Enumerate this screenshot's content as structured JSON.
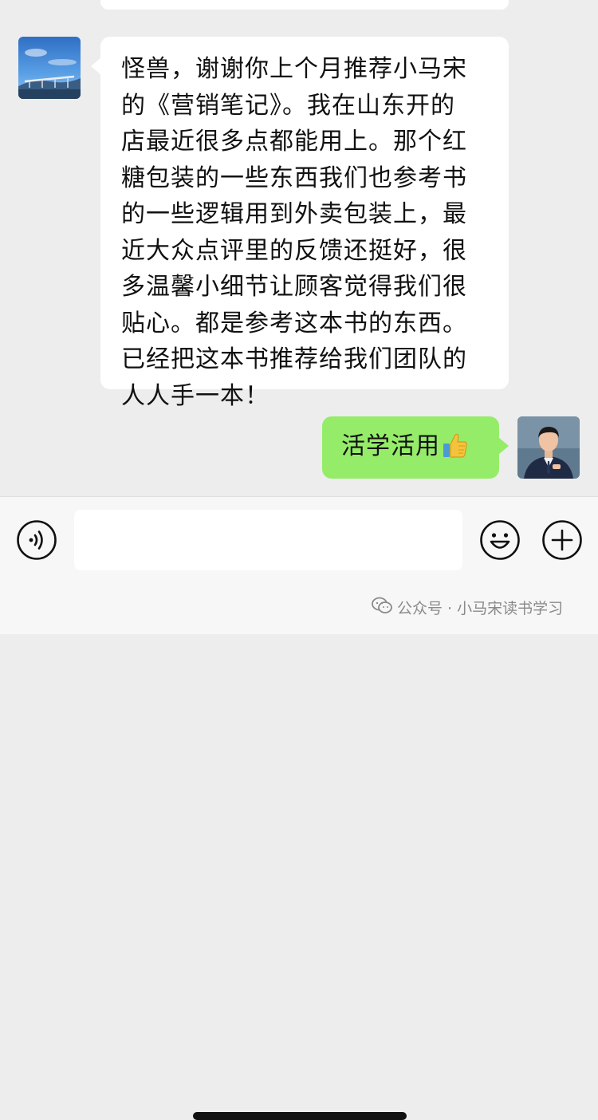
{
  "conversation": {
    "incoming": {
      "lines": [
        "怪兽，谢谢你上个月推荐小马宋",
        "的《营销笔记》。我在山东开的",
        "店最近很多点都能用上。那个红",
        "糖包装的一些东西我们也参考书",
        "的一些逻辑用到外卖包装上，最",
        "近大众点评里的反馈还挺好，很",
        "多温馨小细节让顾客觉得我们很",
        "贴心。都是参考这本书的东西。",
        "已经把这本书推荐给我们团队的",
        "人人手一本！"
      ]
    },
    "outgoing": {
      "text": "活学活用",
      "emoji_icon": "thumbs-up-icon"
    }
  },
  "input_bar": {
    "voice_icon": "voice-icon",
    "emoji_icon": "smiley-icon",
    "plus_icon": "plus-icon"
  },
  "watermark": {
    "text": "公众号 · 小马宋读书学习",
    "icon": "wechat-official-account-icon"
  },
  "colors": {
    "chat_background": "#ededed",
    "incoming_bubble": "#ffffff",
    "outgoing_bubble": "#95ec69",
    "input_bar": "#f7f7f7"
  }
}
